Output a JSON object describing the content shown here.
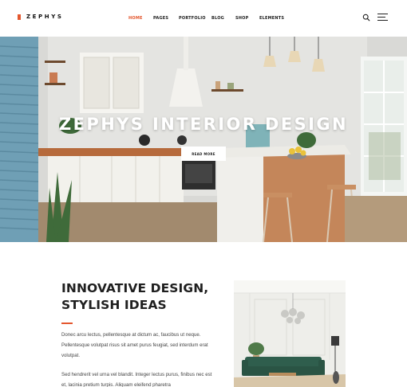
{
  "brand": {
    "name": "ZEPHYS",
    "accent_color": "#e4572e"
  },
  "nav": {
    "items": [
      {
        "label": "HOME",
        "active": true
      },
      {
        "label": "PAGES",
        "active": false
      },
      {
        "label": "PORTFOLIO",
        "active": false
      },
      {
        "label": "BLOG",
        "active": false
      },
      {
        "label": "SHOP",
        "active": false
      },
      {
        "label": "ELEMENTS",
        "active": false
      }
    ],
    "search_icon": "search-icon",
    "menu_icon": "hamburger-menu-icon"
  },
  "hero": {
    "title": "ZEPHYS INTERIOR DESIGN",
    "button_label": "READ MORE"
  },
  "content": {
    "heading_line1": "INNOVATIVE DESIGN,",
    "heading_line2": "STYLISH IDEAS",
    "para1_line1": "Donec arcu lectus, pellentesque at dictum ac, faucibus ut neque.",
    "para1_line2": "Pellentesque volutpat risus sit amet purus feugiat, sed interdum erat",
    "para1_line3": "volutpat.",
    "para2_line1": "Sed hendrerit vel urna vel blandit. Integer lectus purus, finibus nec est",
    "para2_line2": "et, lacinia pretium turpis. Aliquam eleifend pharetra"
  }
}
